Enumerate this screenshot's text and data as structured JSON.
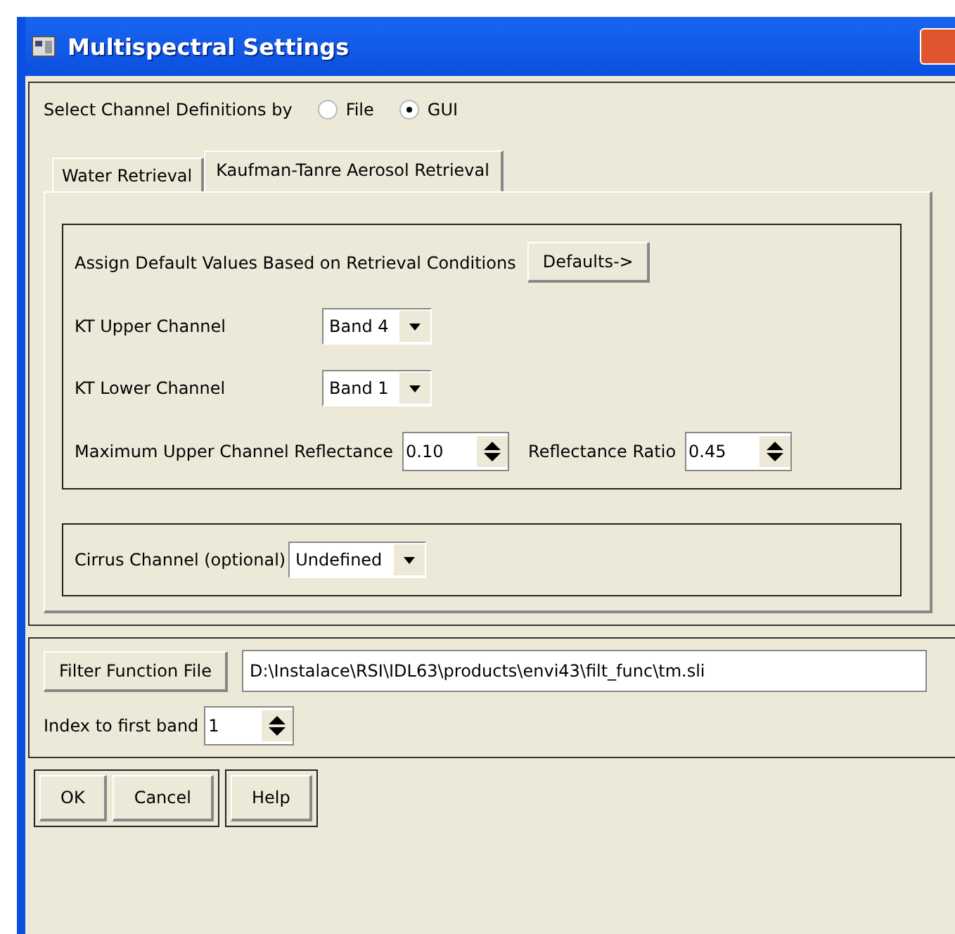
{
  "window": {
    "title": "Multispectral Settings"
  },
  "channel_definitions": {
    "label": "Select Channel Definitions by",
    "options": [
      {
        "label": "File",
        "selected": false
      },
      {
        "label": "GUI",
        "selected": true
      }
    ]
  },
  "tabs": [
    {
      "label": "Water Retrieval",
      "selected": false
    },
    {
      "label": "Kaufman-Tanre Aerosol Retrieval",
      "selected": true
    }
  ],
  "defaults": {
    "label": "Assign Default Values Based on Retrieval Conditions",
    "button": "Defaults->"
  },
  "channels": [
    {
      "label": "KT Upper Channel",
      "value": "Band 4"
    },
    {
      "label": "KT Lower Channel",
      "value": "Band 1"
    }
  ],
  "reflectance": [
    {
      "label": "Maximum Upper Channel Reflectance",
      "value": "0.10"
    },
    {
      "label": "Reflectance Ratio",
      "value": "0.45"
    }
  ],
  "cirrus": {
    "label": "Cirrus Channel (optional)",
    "value": "Undefined"
  },
  "filter_function": {
    "button": "Filter Function File",
    "value": "D:\\Instalace\\RSI\\IDL63\\products\\envi43\\filt_func\\tm.sli"
  },
  "index": {
    "label": "Index to first band",
    "value": "1"
  },
  "buttons": [
    [
      "OK",
      "Cancel"
    ],
    [
      "Help"
    ]
  ]
}
